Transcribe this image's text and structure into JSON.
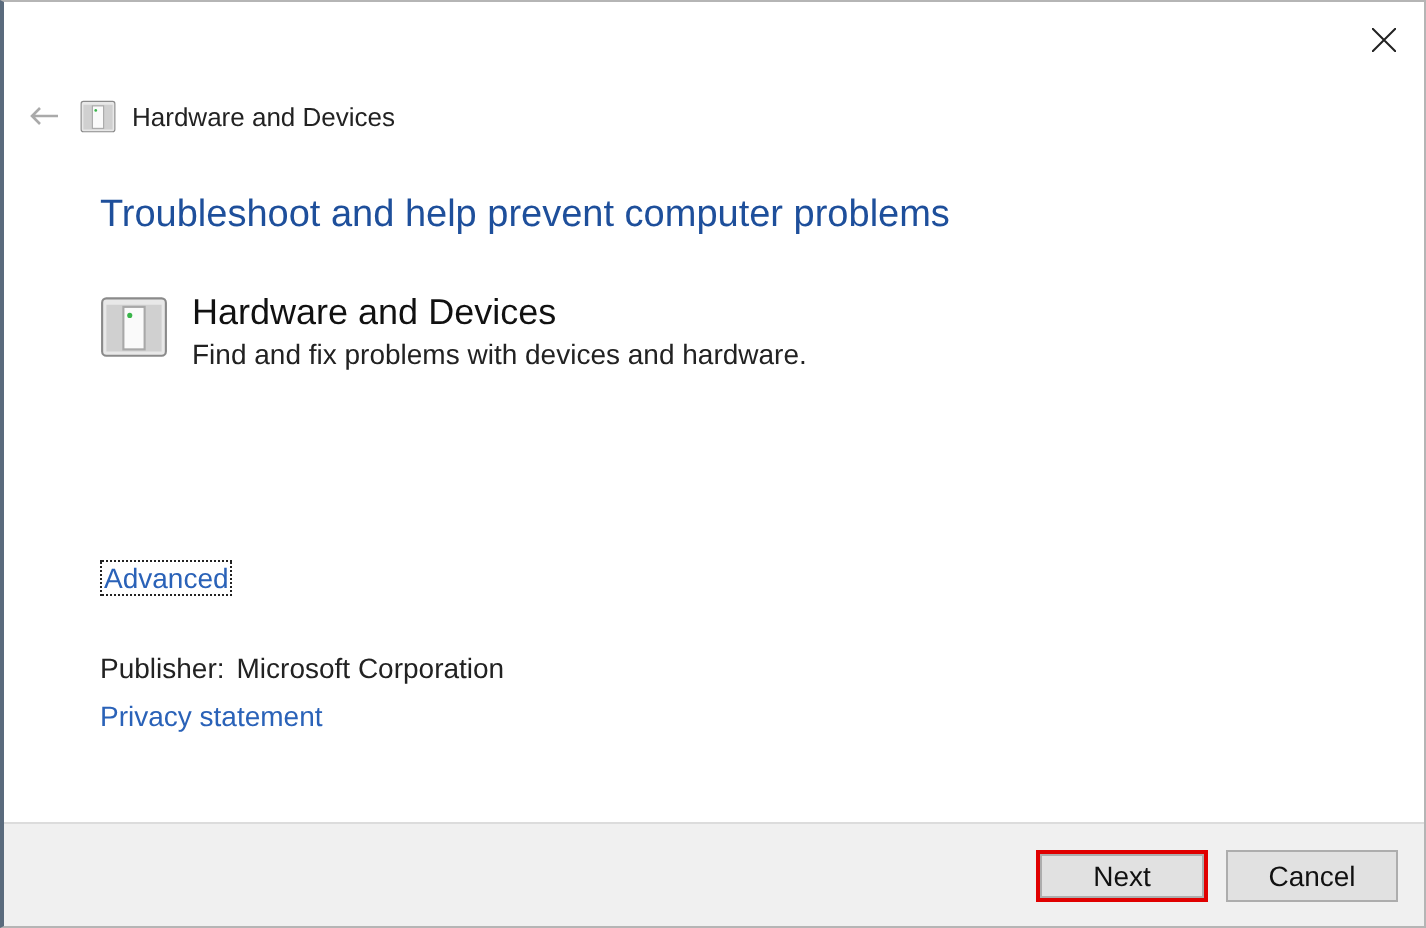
{
  "nav": {
    "title": "Hardware and Devices"
  },
  "heading": "Troubleshoot and help prevent computer problems",
  "item": {
    "title": "Hardware and Devices",
    "description": "Find and fix problems with devices and hardware."
  },
  "advanced": {
    "label": "Advanced",
    "focused": true
  },
  "publisher": {
    "label": "Publisher:",
    "value": "Microsoft Corporation"
  },
  "privacy": "Privacy statement",
  "buttons": [
    {
      "label": "Next",
      "highlighted": true
    },
    {
      "label": "Cancel",
      "highlighted": false
    }
  ]
}
